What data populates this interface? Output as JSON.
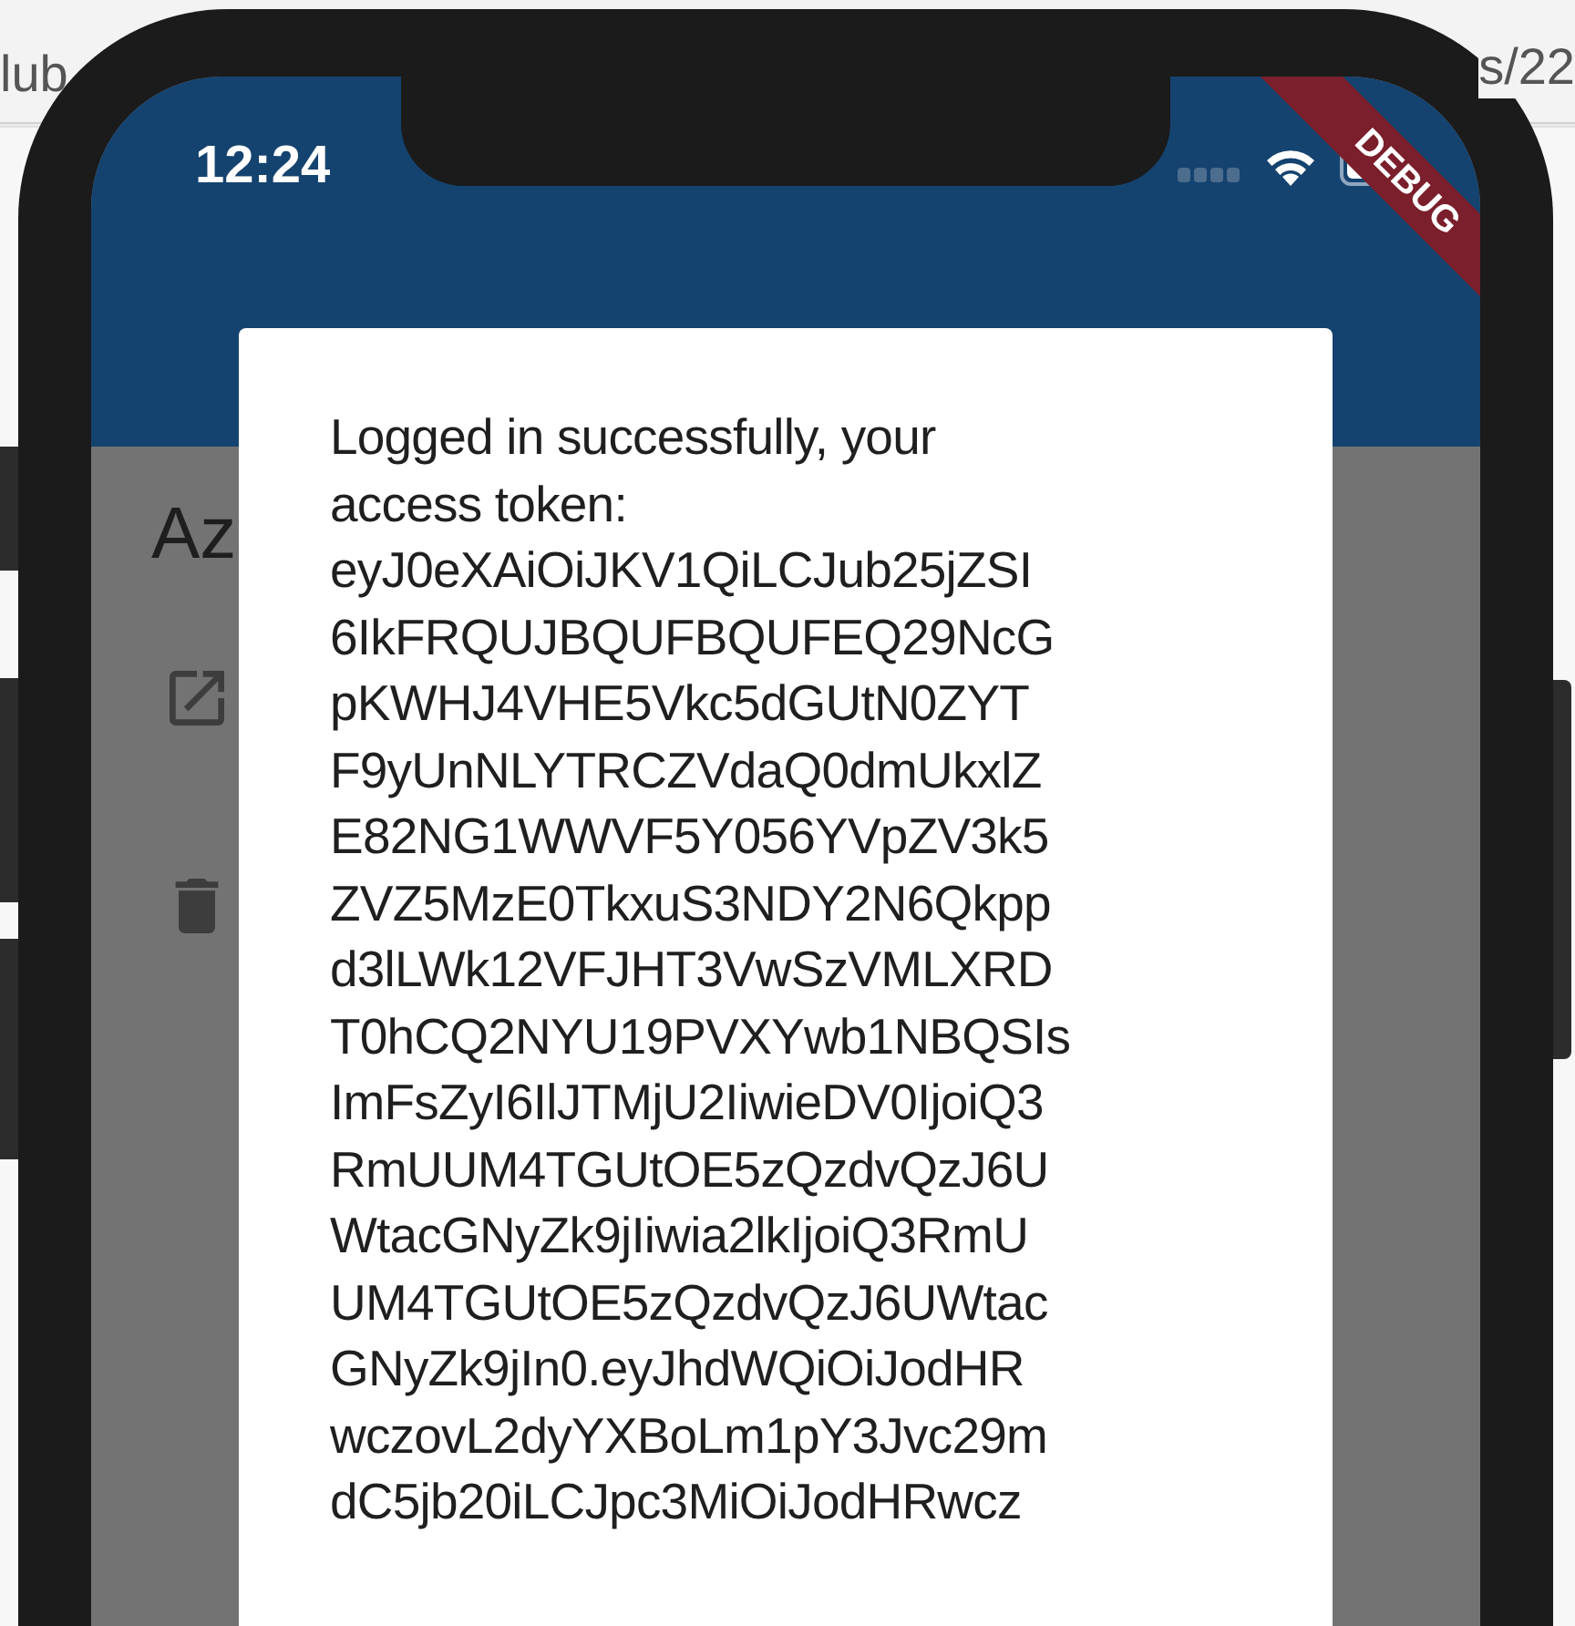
{
  "browser_fragments": {
    "top_left": "lub",
    "top_right": "s/22"
  },
  "status_bar": {
    "time": "12:24"
  },
  "debug_banner": "DEBUG",
  "app": {
    "heading": "Az",
    "actions": [
      {
        "kind": "open"
      },
      {
        "kind": "delete"
      }
    ]
  },
  "dialog": {
    "lines": [
      "Logged in successfully, your",
      "access token:",
      "eyJ0eXAiOiJKV1QiLCJub25jZSI",
      "6IkFRQUJBQUFBQUFEQ29NcG",
      "pKWHJ4VHE5Vkc5dGUtN0ZYT",
      "F9yUnNLYTRCZVdaQ0dmUkxlZ",
      "E82NG1WWVF5Y056YVpZV3k5",
      "ZVZ5MzE0TkxuS3NDY2N6Qkpp",
      "d3lLWk12VFJHT3VwSzVMLXRD",
      "T0hCQ2NYU19PVXYwb1NBQSIs",
      "ImFsZyI6IlJTMjU2IiwieDV0IjoiQ3",
      "RmUUM4TGUtOE5zQzdvQzJ6U",
      "WtacGNyZk9jIiwia2lkIjoiQ3RmU",
      "UM4TGUtOE5zQzdvQzJ6UWtac",
      "GNyZk9jIn0.eyJhdWQiOiJodHR",
      "wczovL2dyYXBoLm1pY3Jvc29m",
      "dC5jb20iLCJpc3MiOiJodHRwcz"
    ]
  }
}
